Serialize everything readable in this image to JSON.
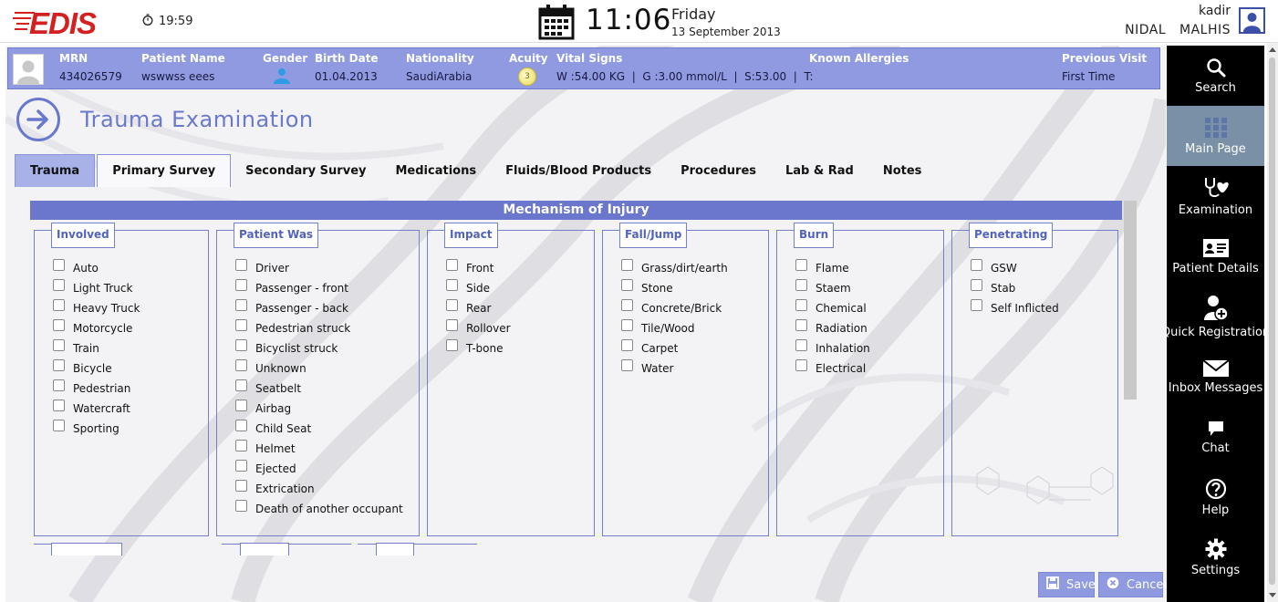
{
  "topbar": {
    "logo_text": "EDIS",
    "timer": "19:59",
    "time": "11:06",
    "day": "Friday",
    "date": "13 September 2013",
    "user_login": "kadir",
    "user_full_name": "NIDAL   MALHIS"
  },
  "patient": {
    "mrn_label": "MRN",
    "mrn": "434026579",
    "name_label": "Patient Name",
    "name": "wswwss eees",
    "gender_label": "Gender",
    "birth_label": "Birth Date",
    "birth": "01.04.2013",
    "nationality_label": "Nationality",
    "nationality": "SaudiArabia",
    "acuity_label": "Acuity",
    "acuity": "3",
    "vitals_label": "Vital Signs",
    "vitals": "W :54.00 KG  |  G :3.00 mmol/L  |  S:53.00  |  T:",
    "allergies_label": "Known Allergies",
    "prev_label": "Previous Visit",
    "prev": "First Time"
  },
  "page": {
    "title": "Trauma Examination"
  },
  "tabs": [
    {
      "label": "Trauma"
    },
    {
      "label": "Primary Survey"
    },
    {
      "label": "Secondary Survey"
    },
    {
      "label": "Medications"
    },
    {
      "label": "Fluids/Blood Products"
    },
    {
      "label": "Procedures"
    },
    {
      "label": "Lab & Rad"
    },
    {
      "label": "Notes"
    }
  ],
  "section": {
    "title": "Mechanism of Injury"
  },
  "groups": [
    {
      "title": "Involved",
      "options": [
        "Auto",
        "Light Truck",
        "Heavy Truck",
        "Motorcycle",
        "Train",
        "Bicycle",
        "Pedestrian",
        "Watercraft",
        "Sporting"
      ]
    },
    {
      "title": "Patient Was",
      "options": [
        "Driver",
        "Passenger - front",
        "Passenger - back",
        "Pedestrian struck",
        "Bicyclist struck",
        "Unknown",
        "Seatbelt",
        "Airbag",
        "Child Seat",
        "Helmet",
        "Ejected",
        "Extrication",
        "Death of another occupant"
      ]
    },
    {
      "title": "Impact",
      "options": [
        "Front",
        "Side",
        "Rear",
        "Rollover",
        "T-bone"
      ]
    },
    {
      "title": "Fall/Jump",
      "options": [
        "Grass/dirt/earth",
        "Stone",
        "Concrete/Brick",
        "Tile/Wood",
        "Carpet",
        "Water"
      ]
    },
    {
      "title": "Burn",
      "options": [
        "Flame",
        "Staem",
        "Chemical",
        "Radiation",
        "Inhalation",
        "Electrical"
      ]
    },
    {
      "title": "Penetrating",
      "options": [
        "GSW",
        "Stab",
        "Self Inflicted"
      ]
    }
  ],
  "buttons": {
    "save": "Save",
    "cancel": "Cancel"
  },
  "sidebar": [
    {
      "label": "Search",
      "icon": "search-icon"
    },
    {
      "label": "Main Page",
      "icon": "grid-icon"
    },
    {
      "label": "Examination",
      "icon": "stethoscope-heart-icon"
    },
    {
      "label": "Patient Details",
      "icon": "id-card-icon"
    },
    {
      "label": "Quick Registration",
      "icon": "add-person-icon"
    },
    {
      "label": "Inbox Messages",
      "icon": "envelope-icon"
    },
    {
      "label": "Chat",
      "icon": "chat-bubble-icon"
    },
    {
      "label": "Help",
      "icon": "question-icon"
    },
    {
      "label": "Settings",
      "icon": "gear-icon"
    }
  ],
  "colors": {
    "accent": "#6a77cc",
    "patient_bar": "#8f9ae0",
    "sidebar_bg": "#000000",
    "sidebar_active": "#7a90a6",
    "logo_red": "#d42020"
  }
}
